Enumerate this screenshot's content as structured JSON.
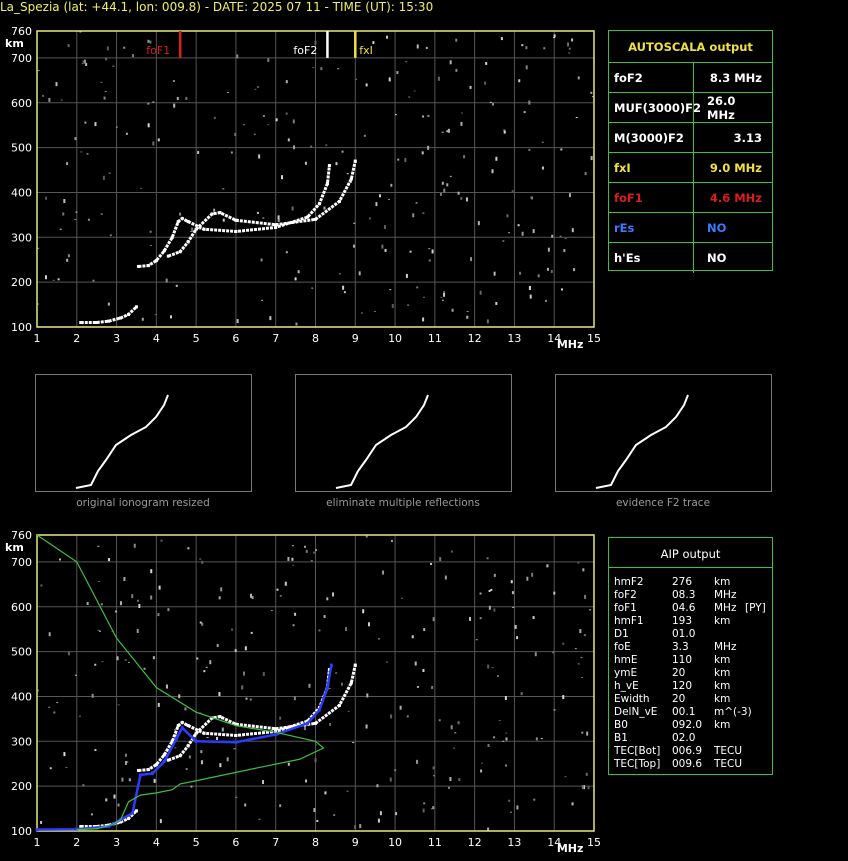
{
  "header": {
    "title": "La_Spezia (lat: +44.1, lon: 009.8) - DATE: 2025 07 11 - TIME (UT): 15:30"
  },
  "colors": {
    "axis": "#e8e87a",
    "grid": "#555555",
    "trace": "#ffffff",
    "fof1": "#d81e1e",
    "fof2": "#ffffff",
    "fxi": "#f0e040",
    "green": "#3fbf3f",
    "blue_fit": "#2a3cff",
    "blue_text": "#3a7cff"
  },
  "chart_data": [
    {
      "type": "scatter",
      "name_key": "ionogram-top",
      "xlabel": "MHz",
      "ylabel": "km",
      "xlim": [
        1,
        15
      ],
      "ylim": [
        100,
        760
      ],
      "x_ticks": [
        1,
        2,
        3,
        4,
        5,
        6,
        7,
        8,
        9,
        10,
        11,
        12,
        13,
        14,
        15
      ],
      "y_ticks": [
        100,
        200,
        300,
        400,
        500,
        600,
        700,
        760
      ],
      "markers": [
        {
          "label": "foF1",
          "x": 4.6,
          "color": "#d81e1e"
        },
        {
          "label": "foF2",
          "x": 8.3,
          "color": "#ffffff"
        },
        {
          "label": "fxI",
          "x": 9.0,
          "color": "#f0e040"
        }
      ],
      "traces": [
        {
          "name": "E",
          "color": "#ffffff",
          "points": [
            [
              2.1,
              110
            ],
            [
              2.5,
              110
            ],
            [
              2.8,
              113
            ],
            [
              3.1,
              120
            ],
            [
              3.3,
              128
            ],
            [
              3.5,
              145
            ]
          ]
        },
        {
          "name": "F1 O",
          "color": "#ffffff",
          "points": [
            [
              3.55,
              235
            ],
            [
              3.8,
              237
            ],
            [
              4.0,
              248
            ],
            [
              4.2,
              270
            ],
            [
              4.4,
              300
            ],
            [
              4.55,
              335
            ],
            [
              4.65,
              342
            ],
            [
              4.8,
              335
            ],
            [
              5.2,
              318
            ],
            [
              6.0,
              313
            ],
            [
              7.0,
              322
            ],
            [
              7.8,
              345
            ],
            [
              8.1,
              375
            ],
            [
              8.3,
              420
            ],
            [
              8.35,
              460
            ]
          ]
        },
        {
          "name": "F X",
          "color": "#ffffff",
          "points": [
            [
              4.3,
              258
            ],
            [
              4.6,
              268
            ],
            [
              4.8,
              290
            ],
            [
              5.0,
              318
            ],
            [
              5.4,
              352
            ],
            [
              5.6,
              355
            ],
            [
              6.0,
              338
            ],
            [
              7.0,
              328
            ],
            [
              8.0,
              340
            ],
            [
              8.6,
              380
            ],
            [
              8.9,
              430
            ],
            [
              9.0,
              470
            ]
          ]
        }
      ]
    },
    {
      "type": "scatter",
      "name_key": "ionogram-bottom",
      "xlabel": "MHz",
      "ylabel": "km",
      "xlim": [
        1,
        15
      ],
      "ylim": [
        100,
        760
      ],
      "x_ticks": [
        1,
        2,
        3,
        4,
        5,
        6,
        7,
        8,
        9,
        10,
        11,
        12,
        13,
        14,
        15
      ],
      "y_ticks": [
        100,
        200,
        300,
        400,
        500,
        600,
        700,
        760
      ],
      "traces": [
        {
          "name": "E",
          "color": "#ffffff",
          "points": [
            [
              2.1,
              110
            ],
            [
              2.5,
              110
            ],
            [
              2.8,
              113
            ],
            [
              3.1,
              120
            ],
            [
              3.3,
              128
            ],
            [
              3.5,
              145
            ]
          ]
        },
        {
          "name": "F1 O",
          "color": "#ffffff",
          "points": [
            [
              3.55,
              235
            ],
            [
              3.8,
              237
            ],
            [
              4.0,
              248
            ],
            [
              4.2,
              270
            ],
            [
              4.4,
              300
            ],
            [
              4.55,
              335
            ],
            [
              4.65,
              342
            ],
            [
              4.8,
              335
            ],
            [
              5.2,
              318
            ],
            [
              6.0,
              313
            ],
            [
              7.0,
              322
            ],
            [
              7.8,
              345
            ],
            [
              8.1,
              375
            ],
            [
              8.3,
              420
            ],
            [
              8.35,
              460
            ]
          ]
        },
        {
          "name": "F X",
          "color": "#ffffff",
          "points": [
            [
              4.3,
              258
            ],
            [
              4.6,
              268
            ],
            [
              4.8,
              290
            ],
            [
              5.0,
              318
            ],
            [
              5.4,
              352
            ],
            [
              5.6,
              355
            ],
            [
              6.0,
              338
            ],
            [
              7.0,
              328
            ],
            [
              8.0,
              340
            ],
            [
              8.6,
              380
            ],
            [
              8.9,
              430
            ],
            [
              9.0,
              470
            ]
          ]
        },
        {
          "name": "blue fit",
          "color": "#2a3cff",
          "points": [
            [
              1.0,
              103
            ],
            [
              2.0,
              104
            ],
            [
              2.8,
              110
            ],
            [
              3.1,
              125
            ],
            [
              3.4,
              140
            ],
            [
              3.6,
              225
            ],
            [
              3.9,
              228
            ],
            [
              4.2,
              255
            ],
            [
              4.5,
              305
            ],
            [
              4.65,
              330
            ],
            [
              5.0,
              300
            ],
            [
              6.0,
              298
            ],
            [
              7.0,
              315
            ],
            [
              7.8,
              340
            ],
            [
              8.1,
              370
            ],
            [
              8.3,
              420
            ],
            [
              8.4,
              470
            ]
          ]
        },
        {
          "name": "green profile",
          "color": "#3fbf3f",
          "points": [
            [
              2.0,
              103
            ],
            [
              2.5,
              105
            ],
            [
              2.9,
              115
            ],
            [
              3.1,
              125
            ],
            [
              3.3,
              165
            ],
            [
              3.6,
              180
            ],
            [
              4.0,
              185
            ],
            [
              4.4,
              192
            ],
            [
              4.6,
              205
            ],
            [
              5.0,
              212
            ],
            [
              6.5,
              240
            ],
            [
              7.6,
              260
            ],
            [
              8.2,
              285
            ],
            [
              8.0,
              300
            ],
            [
              7.0,
              320
            ],
            [
              6.0,
              335
            ],
            [
              5.0,
              365
            ],
            [
              4.0,
              420
            ],
            [
              3.0,
              530
            ],
            [
              2.0,
              700
            ],
            [
              1.0,
              760
            ]
          ]
        }
      ]
    }
  ],
  "autoscala": {
    "title": "AUTOSCALA output",
    "rows": [
      {
        "label": "foF2",
        "value": "8.3 MHz",
        "color": "#ffffff"
      },
      {
        "label": "MUF(3000)F2",
        "value": "26.0 MHz",
        "color": "#ffffff"
      },
      {
        "label": "M(3000)F2",
        "value": "3.13",
        "color": "#ffffff"
      },
      {
        "label": "fxI",
        "value": "9.0 MHz",
        "color": "#f0e040"
      },
      {
        "label": "foF1",
        "value": "4.6 MHz",
        "color": "#d81e1e"
      },
      {
        "label": "rEs",
        "value": "NO",
        "color": "#3a7cff"
      },
      {
        "label": "h'Es",
        "value": "NO",
        "color": "#ffffff"
      }
    ]
  },
  "thumbnails": [
    {
      "caption": "original ionogram resized"
    },
    {
      "caption": "eliminate multiple reflections"
    },
    {
      "caption": "evidence F2 trace"
    }
  ],
  "aip": {
    "title": "AIP output",
    "rows": [
      {
        "name": "hmF2",
        "value": "276",
        "unit": "km",
        "extra": ""
      },
      {
        "name": "foF2",
        "value": "08.3",
        "unit": "MHz",
        "extra": ""
      },
      {
        "name": "foF1",
        "value": "04.6",
        "unit": "MHz",
        "extra": "[PY]"
      },
      {
        "name": "hmF1",
        "value": "193",
        "unit": "km",
        "extra": ""
      },
      {
        "name": "D1",
        "value": "01.0",
        "unit": "",
        "extra": ""
      },
      {
        "name": "foE",
        "value": "3.3",
        "unit": "MHz",
        "extra": ""
      },
      {
        "name": "hmE",
        "value": "110",
        "unit": "km",
        "extra": ""
      },
      {
        "name": "ymE",
        "value": "20",
        "unit": "km",
        "extra": ""
      },
      {
        "name": "h_vE",
        "value": "120",
        "unit": "km",
        "extra": ""
      },
      {
        "name": "Ewidth",
        "value": "20",
        "unit": "km",
        "extra": ""
      },
      {
        "name": "DelN_vE",
        "value": "00.1",
        "unit": "m^(-3)",
        "extra": ""
      },
      {
        "name": "B0",
        "value": "092.0",
        "unit": "km",
        "extra": ""
      },
      {
        "name": "B1",
        "value": "02.0",
        "unit": "",
        "extra": ""
      },
      {
        "name": "TEC[Bot]",
        "value": "006.9",
        "unit": "TECU",
        "extra": ""
      },
      {
        "name": "TEC[Top]",
        "value": "009.6",
        "unit": "TECU",
        "extra": ""
      }
    ]
  }
}
